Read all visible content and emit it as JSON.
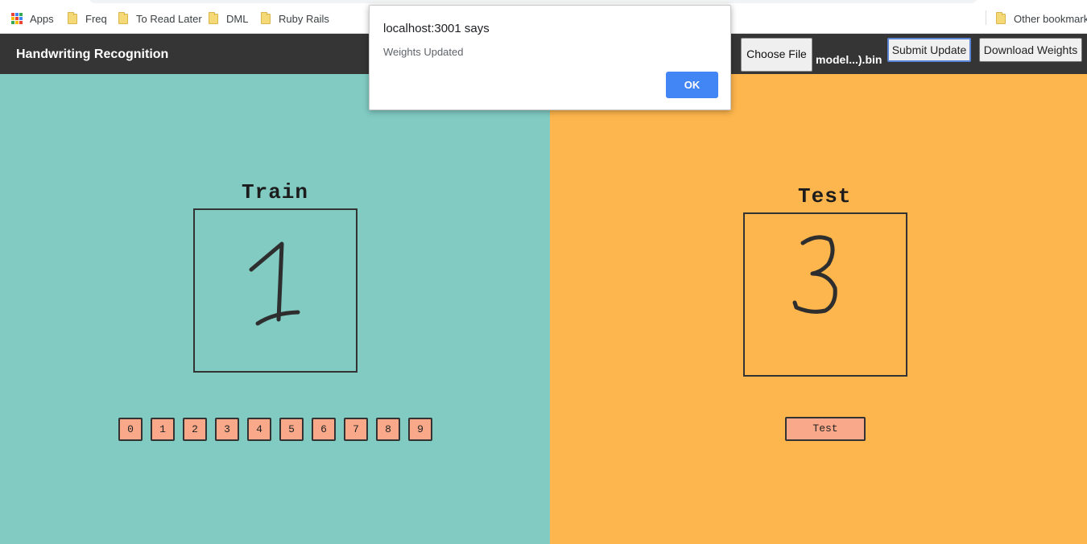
{
  "bookmarks": {
    "apps_label": "Apps",
    "items": [
      "Freq",
      "To Read Later",
      "DML",
      "Ruby Rails"
    ],
    "other_label": "Other bookmarks"
  },
  "header": {
    "title": "Handwriting Recognition",
    "choose_file_label": "Choose File",
    "file_name": "model...).bin",
    "submit_label": "Submit Update",
    "download_label": "Download Weights"
  },
  "train": {
    "heading": "Train",
    "drawn_digit": "1",
    "digit_buttons": [
      "0",
      "1",
      "2",
      "3",
      "4",
      "5",
      "6",
      "7",
      "8",
      "9"
    ]
  },
  "test": {
    "heading": "Test",
    "drawn_digit": "3",
    "button_label": "Test"
  },
  "dialog": {
    "title": "localhost:3001 says",
    "message": "Weights Updated",
    "ok_label": "OK"
  },
  "colors": {
    "train_bg": "#81cbc3",
    "test_bg": "#fdb54d",
    "header_bg": "#353535",
    "button_bg": "#f9a98a",
    "dialog_ok": "#4285f4"
  }
}
